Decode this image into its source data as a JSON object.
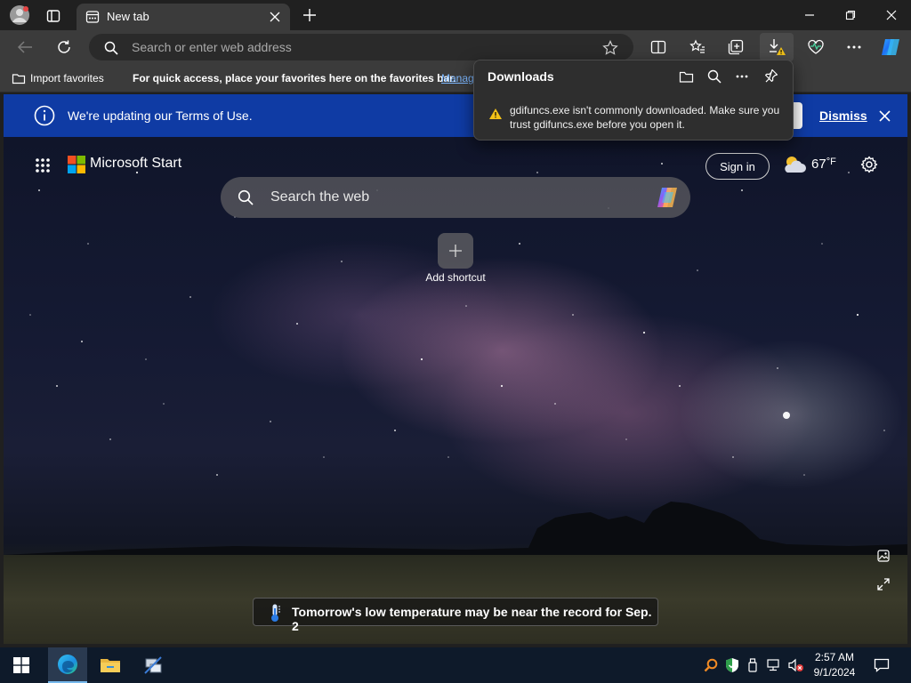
{
  "browser": {
    "tab_title": "New tab",
    "address_placeholder": "Search or enter web address"
  },
  "favorites_bar": {
    "import_label": "Import favorites",
    "hint_text": "For quick access, place your favorites here on the favorites bar.",
    "manage_link": "Manag"
  },
  "info_bar": {
    "message": "We're updating our Terms of Use.",
    "dismiss_label": "Dismiss"
  },
  "downloads_panel": {
    "title": "Downloads",
    "warning": "gdifuncs.exe isn't commonly downloaded. Make sure you trust gdifuncs.exe before you open it."
  },
  "start_page": {
    "brand": "Microsoft Start",
    "search_placeholder": "Search the web",
    "sign_in_label": "Sign in",
    "weather_temp": "67",
    "weather_unit": "°F",
    "add_shortcut_label": "Add shortcut",
    "news_text": "Tomorrow's low temperature may be near the record for Sep. 2"
  },
  "taskbar": {
    "time": "2:57 AM",
    "date": "9/1/2024"
  },
  "colors": {
    "info_bar_bg": "#0f3ba4",
    "warning_yellow": "#f3c318",
    "link_blue": "#7cb7ff"
  }
}
